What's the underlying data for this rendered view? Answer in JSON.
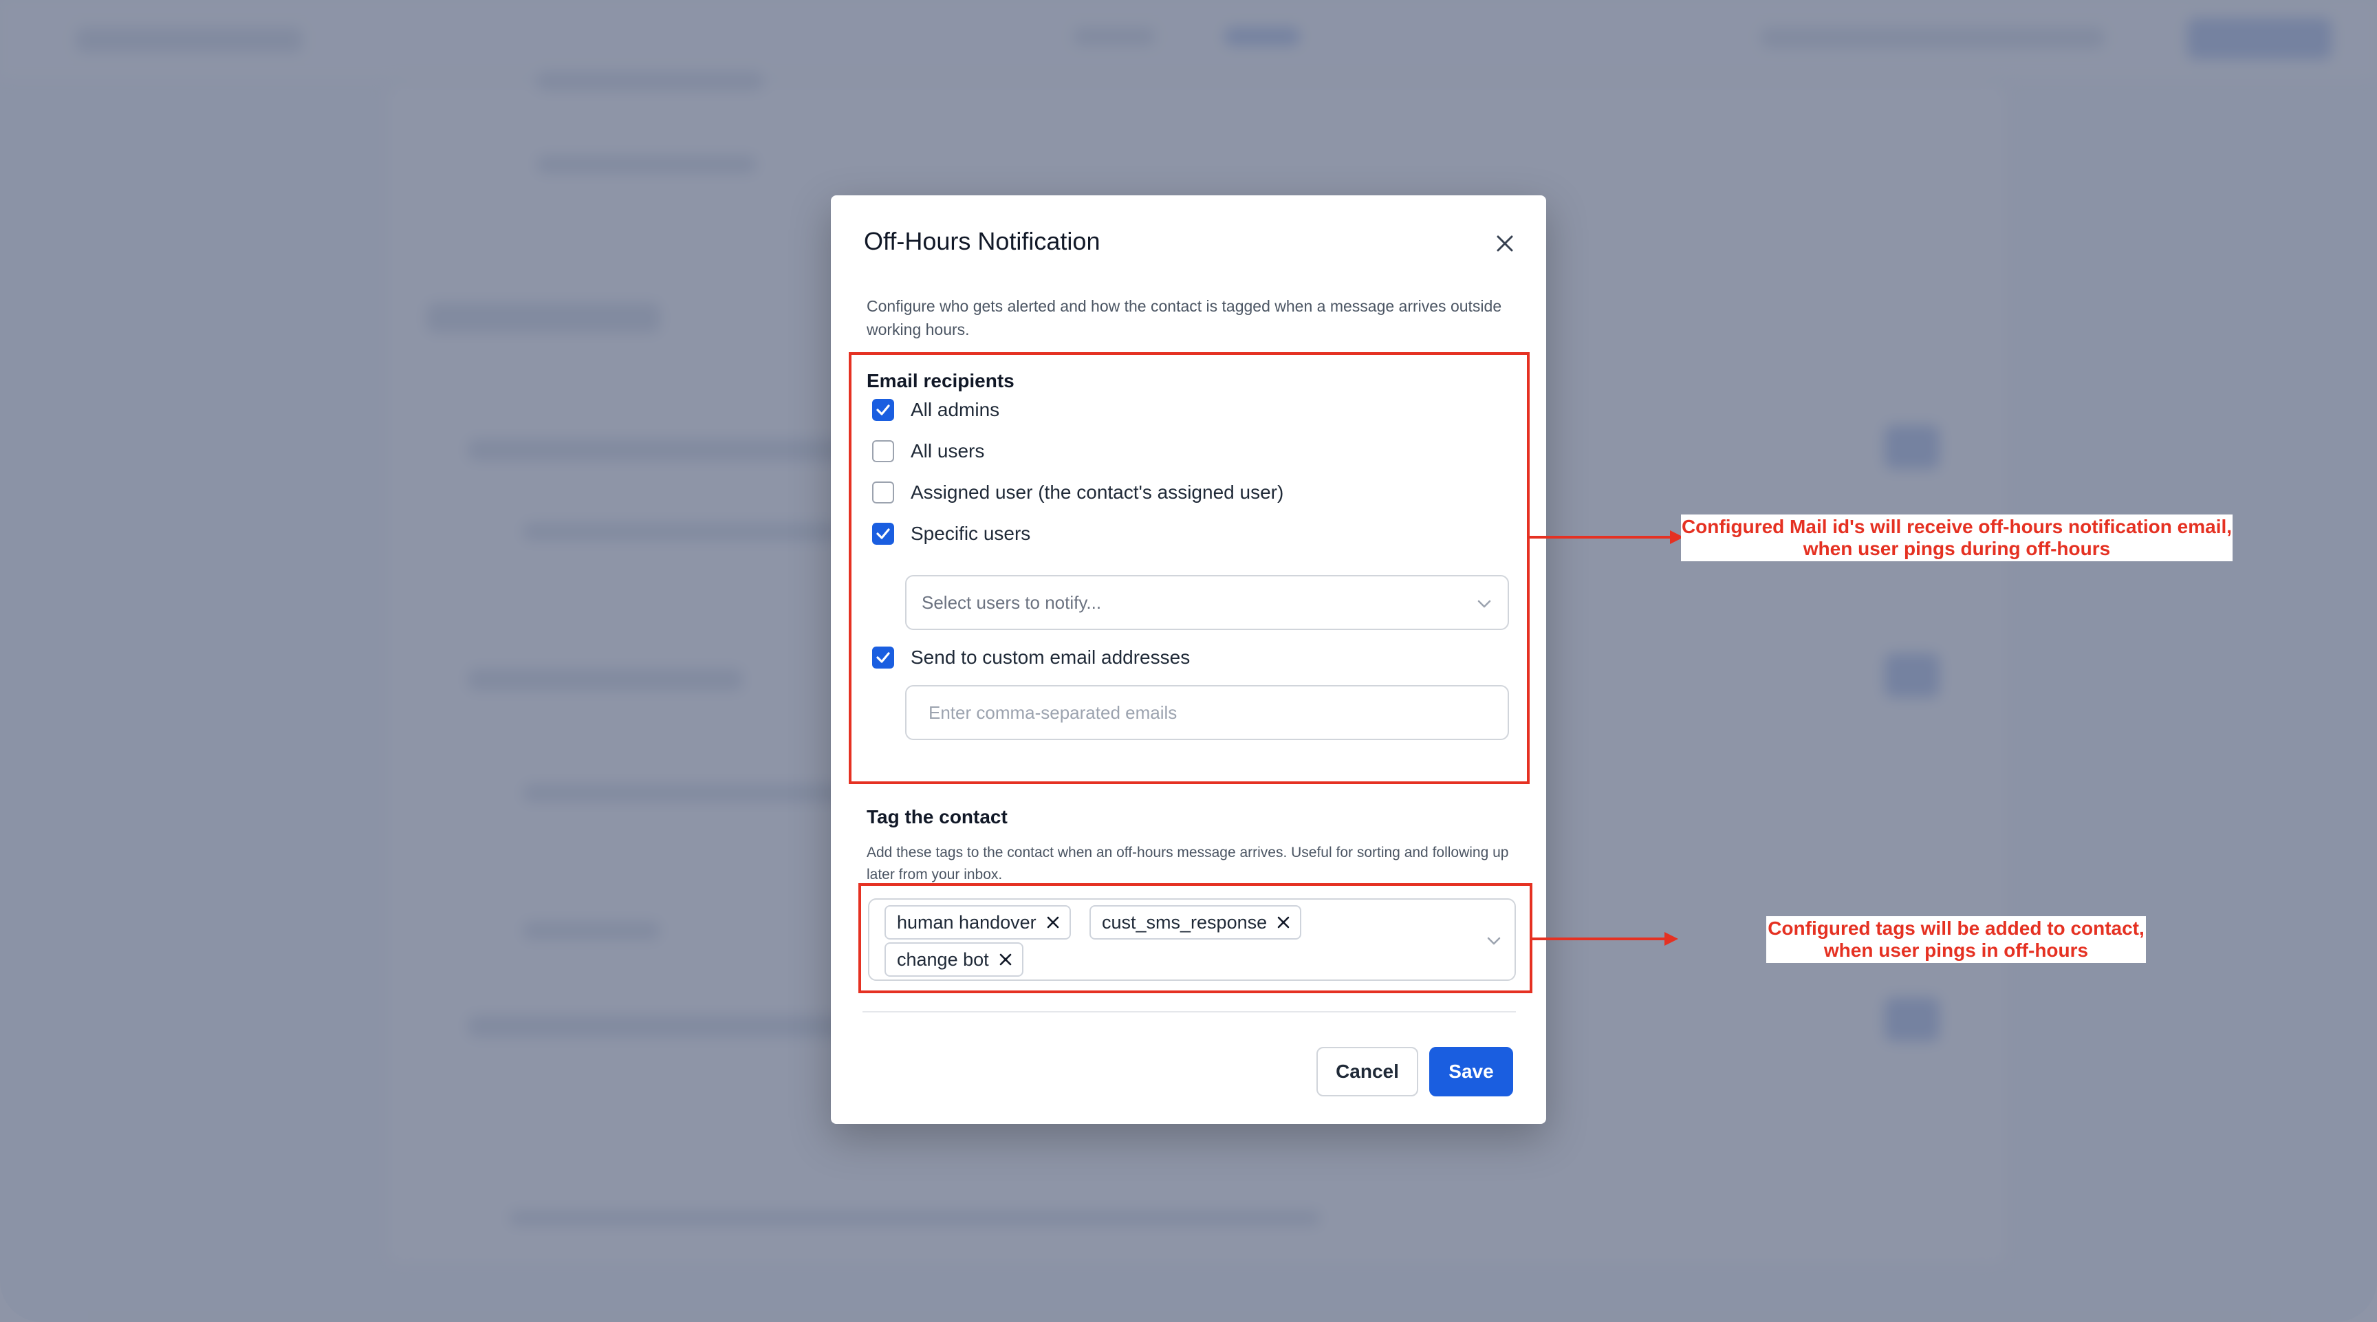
{
  "colors": {
    "accent": "#1a5ee0",
    "annotation": "#e53122",
    "overlay": "rgba(102,112,136,0.74)"
  },
  "modal": {
    "title": "Off-Hours Notification",
    "close_icon": "close-icon",
    "description": "Configure who gets alerted and how the contact is tagged when a message arrives outside working hours."
  },
  "email_recipients": {
    "title": "Email recipients",
    "options": [
      {
        "label": "All admins",
        "checked": true
      },
      {
        "label": "All users",
        "checked": false
      },
      {
        "label": "Assigned user (the contact's assigned user)",
        "checked": false
      },
      {
        "label": "Specific users",
        "checked": true
      },
      {
        "label": "Send to custom email addresses",
        "checked": true
      }
    ],
    "user_select_placeholder": "Select users to notify...",
    "email_input_placeholder": "Enter comma-separated emails"
  },
  "tag_contact": {
    "title": "Tag the contact",
    "description": "Add these tags to the contact when an off-hours message arrives. Useful for sorting and following up later from your inbox.",
    "tags": [
      "human handover",
      "cust_sms_response",
      "change bot"
    ]
  },
  "footer": {
    "cancel_label": "Cancel",
    "save_label": "Save"
  },
  "annotations": [
    {
      "line1": "Configured Mail id's will receive off-hours notification email,",
      "line2": "when user pings during off-hours"
    },
    {
      "line1": "Configured tags will be added to contact,",
      "line2": "when user pings in off-hours"
    }
  ]
}
